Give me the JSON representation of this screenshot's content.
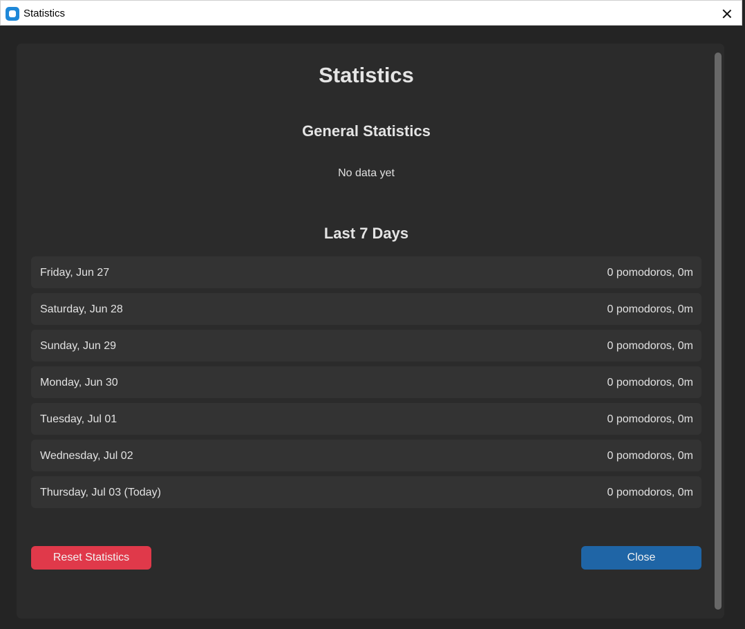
{
  "window": {
    "title": "Statistics"
  },
  "dialog": {
    "title": "Statistics",
    "general_heading": "General Statistics",
    "general_text": "No data yet",
    "days_heading": "Last 7 Days"
  },
  "days": [
    {
      "label": "Friday, Jun 27",
      "value": "0 pomodoros, 0m"
    },
    {
      "label": "Saturday, Jun 28",
      "value": "0 pomodoros, 0m"
    },
    {
      "label": "Sunday, Jun 29",
      "value": "0 pomodoros, 0m"
    },
    {
      "label": "Monday, Jun 30",
      "value": "0 pomodoros, 0m"
    },
    {
      "label": "Tuesday, Jul 01",
      "value": "0 pomodoros, 0m"
    },
    {
      "label": "Wednesday, Jul 02",
      "value": "0 pomodoros, 0m"
    },
    {
      "label": "Thursday, Jul 03 (Today)",
      "value": "0 pomodoros, 0m"
    }
  ],
  "buttons": {
    "reset_label": "Reset Statistics",
    "close_label": "Close"
  },
  "colors": {
    "background": "#242424",
    "panel": "#2b2b2b",
    "row": "#333333",
    "reset_button": "#e0394a",
    "close_button": "#1f65a6",
    "app_icon": "#1e88d8"
  },
  "icons": {
    "app": "app-icon",
    "close": "close-icon"
  }
}
